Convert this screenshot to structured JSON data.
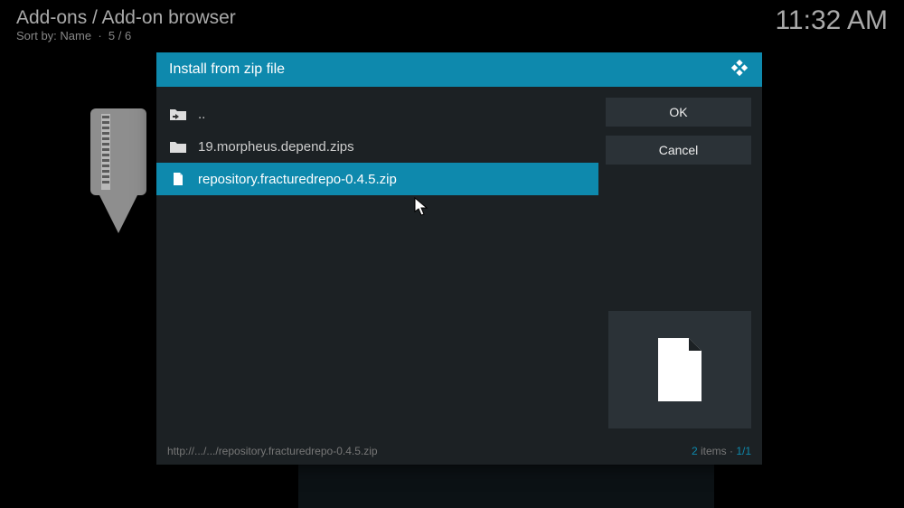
{
  "header": {
    "breadcrumb": "Add-ons / Add-on browser",
    "sort_label": "Sort by: Name",
    "sort_count": "5 / 6"
  },
  "clock": "11:32 AM",
  "dialog": {
    "title": "Install from zip file",
    "items": {
      "up": "..",
      "folder": "19.morpheus.depend.zips",
      "file": "repository.fracturedrepo-0.4.5.zip"
    },
    "buttons": {
      "ok": "OK",
      "cancel": "Cancel"
    },
    "footer": {
      "path": "http://.../.../repository.fracturedrepo-0.4.5.zip",
      "count": "2",
      "count_label": " items · ",
      "page": "1/1"
    }
  }
}
